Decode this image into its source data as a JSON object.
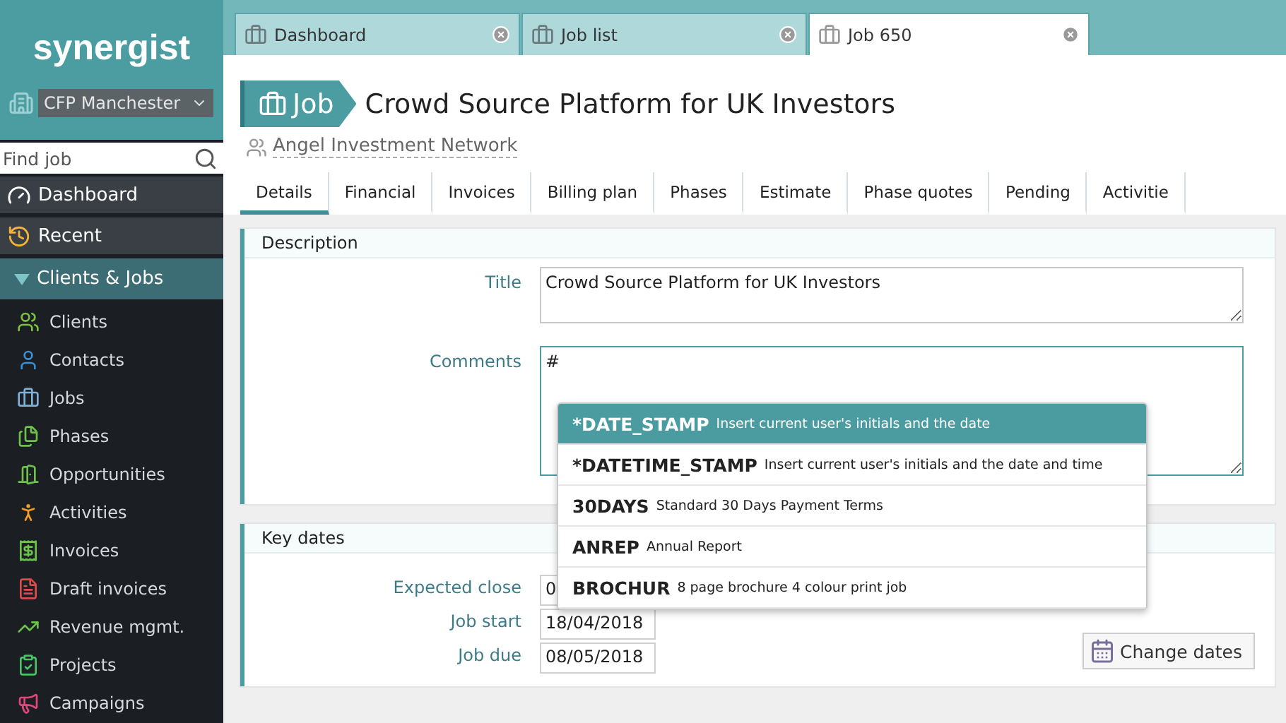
{
  "sidebar": {
    "logo": "synergist",
    "office": "CFP Manchester",
    "search": {
      "placeholder": "Find job"
    },
    "sections": [
      {
        "label": "Dashboard",
        "kind": "link",
        "expanded": false
      },
      {
        "label": "Recent",
        "kind": "link",
        "expanded": false
      },
      {
        "label": "Clients & Jobs",
        "kind": "group",
        "expanded": true
      }
    ],
    "items": [
      "Clients",
      "Contacts",
      "Jobs",
      "Phases",
      "Opportunities",
      "Activities",
      "Invoices",
      "Draft invoices",
      "Revenue mgmt.",
      "Projects",
      "Campaigns"
    ]
  },
  "tabs": [
    {
      "label": "Dashboard",
      "selected": false
    },
    {
      "label": "Job list",
      "selected": false
    },
    {
      "label": "Job 650",
      "selected": true
    }
  ],
  "header": {
    "badge": "Job",
    "title": "Crowd Source Platform for UK Investors",
    "client": "Angel Investment Network"
  },
  "subtabs": [
    {
      "label": "Details",
      "selected": true
    },
    {
      "label": "Financial",
      "selected": false
    },
    {
      "label": "Invoices",
      "selected": false
    },
    {
      "label": "Billing plan",
      "selected": false
    },
    {
      "label": "Phases",
      "selected": false
    },
    {
      "label": "Estimate",
      "selected": false
    },
    {
      "label": "Phase quotes",
      "selected": false
    },
    {
      "label": "Pending",
      "selected": false
    },
    {
      "label": "Activitie",
      "selected": false
    }
  ],
  "description": {
    "heading": "Description",
    "fields": [
      {
        "label": "Title",
        "value": "Crowd Source Platform for UK Investors",
        "focused": false
      },
      {
        "label": "Comments",
        "value": "#",
        "focused": true
      }
    ]
  },
  "suggestions": [
    {
      "code": "*DATE_STAMP",
      "text": "Insert current user's initials and the date",
      "selected": true
    },
    {
      "code": "*DATETIME_STAMP",
      "text": "Insert current user's initials and the date and time",
      "selected": false
    },
    {
      "code": "30DAYS",
      "text": "Standard 30 Days Payment Terms",
      "selected": false
    },
    {
      "code": "ANREP",
      "text": "Annual Report",
      "selected": false
    },
    {
      "code": "BROCHUR",
      "text": "8 page brochure 4 colour print job",
      "selected": false
    }
  ],
  "key_dates": {
    "heading": "Key dates",
    "fields": [
      {
        "label": "Expected close",
        "value": "0"
      },
      {
        "label": "Job start",
        "value": "18/04/2018"
      },
      {
        "label": "Job due",
        "value": "08/05/2018"
      }
    ],
    "button": "Change dates"
  }
}
